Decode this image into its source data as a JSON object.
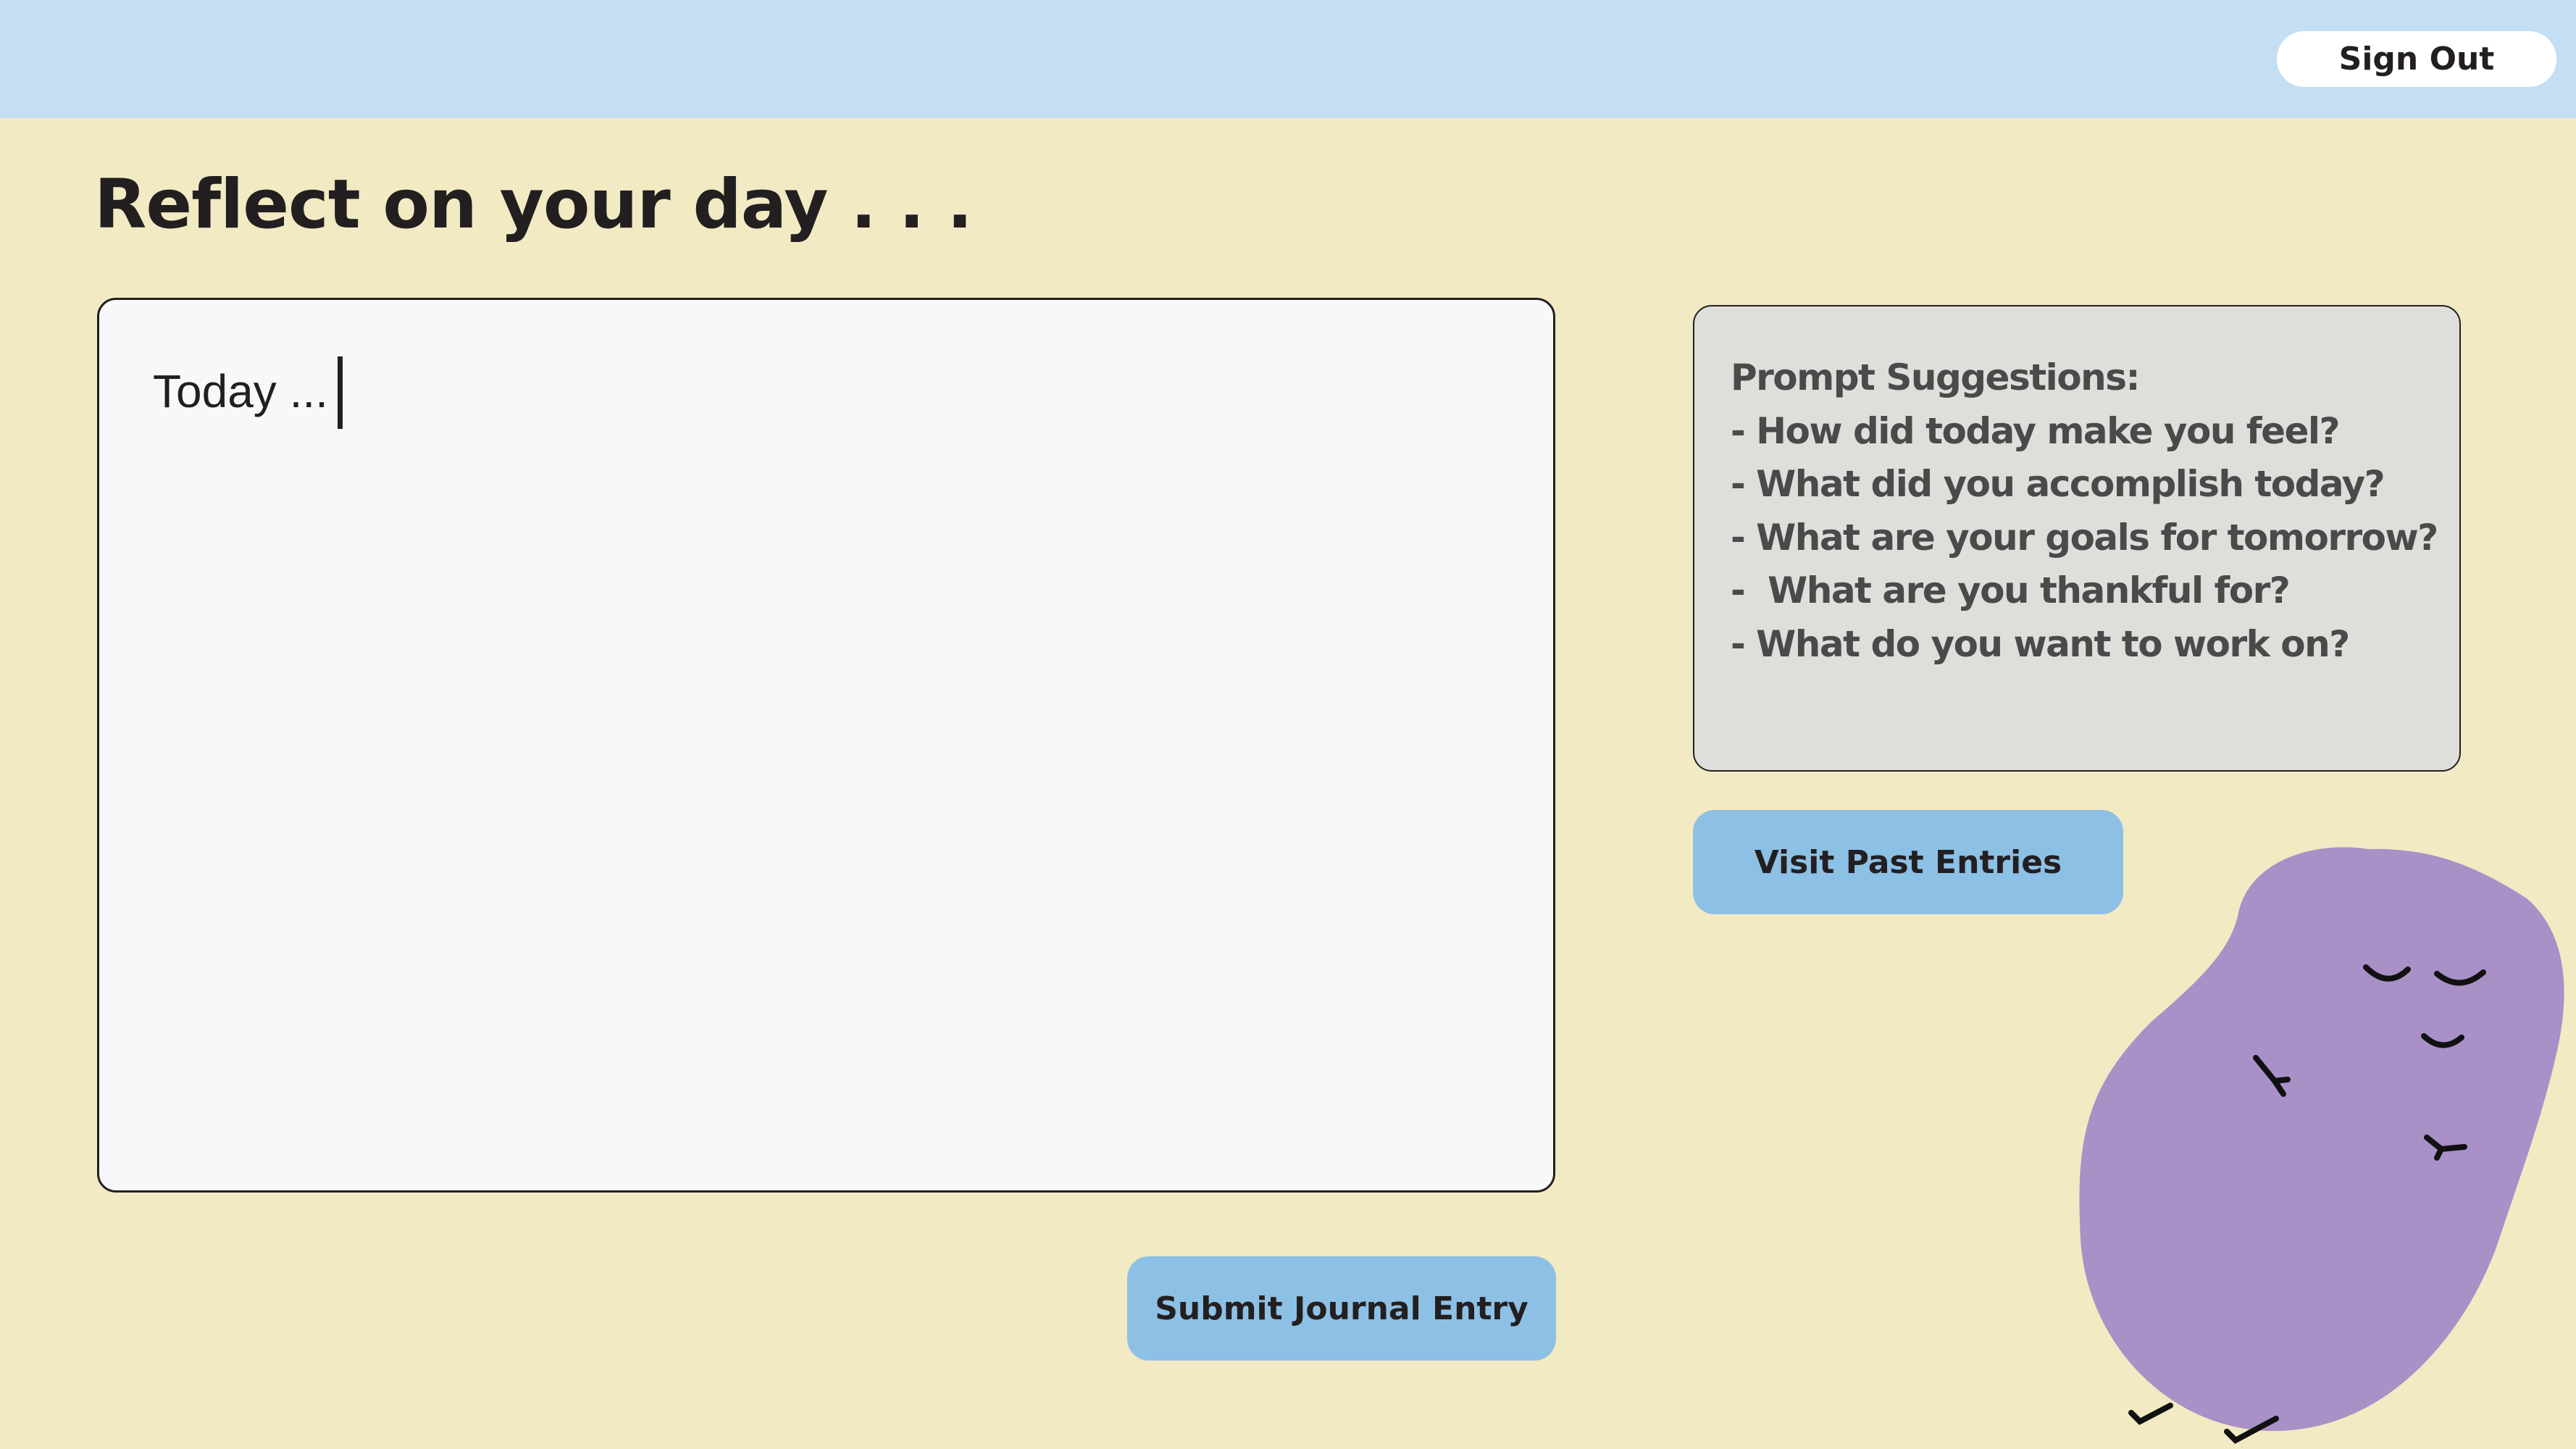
{
  "header": {
    "sign_out_label": "Sign Out"
  },
  "page": {
    "title": "Reflect on your day . . ."
  },
  "journal": {
    "value": "Today ..."
  },
  "prompts": {
    "heading": "Prompt Suggestions:",
    "items": [
      "- How did today make you feel?",
      "- What did you accomplish today?",
      "- What are your goals for tomorrow?",
      "-  What are you thankful for?",
      "- What do you want to work on?"
    ]
  },
  "actions": {
    "visit_past_label": "Visit Past Entries",
    "submit_label": "Submit Journal Entry"
  },
  "colors": {
    "background": "#f2eac3",
    "header": "#c4dff3",
    "button": "#8dc0e5",
    "prompt_box": "#dedfda",
    "mascot": "#a990c7"
  },
  "mascot": {
    "icon": "sleeping-blob-mascot-icon"
  }
}
